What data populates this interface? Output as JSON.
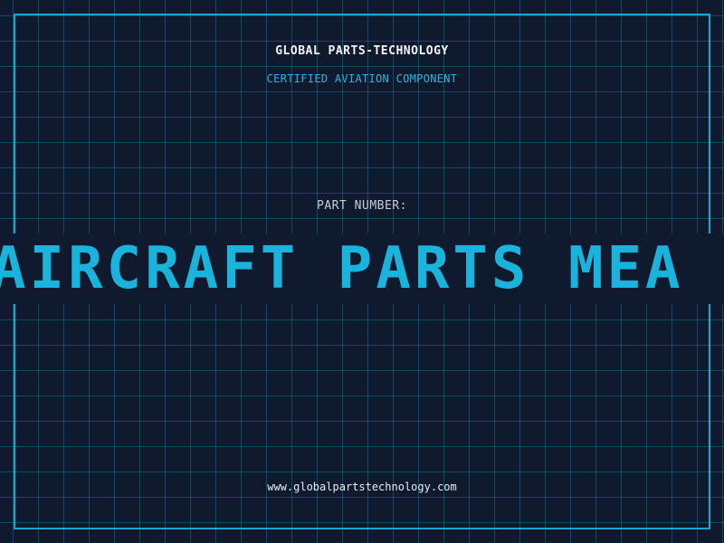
{
  "header": {
    "brand": "GLOBAL PARTS-TECHNOLOGY",
    "subtitle": "CERTIFIED AVIATION COMPONENT"
  },
  "part": {
    "label": "PART NUMBER:",
    "value": "AIRCRAFT PARTS MEA"
  },
  "footer": {
    "url": "www.globalpartstechnology.com"
  },
  "colors": {
    "background": "#101a2e",
    "accent": "#1aa6d2",
    "text": "#f2f4f8"
  }
}
